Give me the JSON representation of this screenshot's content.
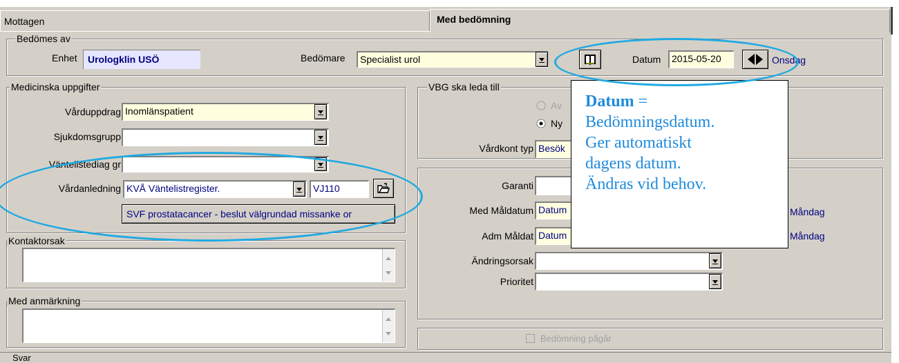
{
  "tabs": {
    "tab1": "Mottagen",
    "tab2": "Med bedömning"
  },
  "bedomes_av": {
    "legend": "Bedömes av",
    "enhet_label": "Enhet",
    "enhet_value": "Urologklin USÖ",
    "bedomare_label": "Bedömare",
    "bedomare_value": "Specialist urol",
    "datum_label": "Datum",
    "datum_value": "2015-05-20",
    "weekday": "Onsdag"
  },
  "medicinska": {
    "legend": "Medicinska uppgifter",
    "varduppdrag_label": "Vårduppdrag",
    "varduppdrag_value": "Inomlänspatient",
    "sjukdomsgrupp_label": "Sjukdomsgrupp",
    "vantelistediag_label": "Väntelistediag gr",
    "vardanledning_label": "Vårdanledning",
    "vardanledning_value": "KVÅ Väntelistregister.",
    "code_value": "VJ110",
    "svf_button": "SVF prostatacancer - beslut välgrundad missanke or"
  },
  "kontaktorsak": {
    "legend": "Kontaktorsak"
  },
  "med_anmarkning": {
    "legend": "Med anmärkning"
  },
  "vbg": {
    "legend": "VBG ska leda till",
    "radio1": "Av",
    "radio2": "Ny",
    "vardkont_label": "Vårdkont typ",
    "vardkont_value": "Besök"
  },
  "garanti": {
    "garanti_label": "Garanti",
    "med_maldatum_label": "Med Måldatum",
    "med_maldatum_value": "Datum",
    "med_maldatum_day": "Måndag",
    "adm_maldat_label": "Adm Måldat",
    "adm_maldat_value": "Datum",
    "adm_maldat_day": "Måndag",
    "andringsorsak_label": "Ändringsorsak",
    "prioritet_label": "Prioritet"
  },
  "bedomning_pagar": "Bedömning pågår",
  "status_label": "Svar",
  "callout": {
    "title": "Datum",
    "eq": " =",
    "line1": "Bedömningsdatum.",
    "line2": "Ger automatiskt",
    "line3": "dagens datum.",
    "line4": "Ändras vid behov."
  },
  "colors": {
    "annotation": "#1fa9e1",
    "callout_text": "#1f8bdc",
    "window": "#d4d0c8",
    "link": "#000080"
  },
  "icons": {
    "book": "book-icon",
    "nav": "prev-next-arrows-icon",
    "open": "open-folder-icon"
  }
}
